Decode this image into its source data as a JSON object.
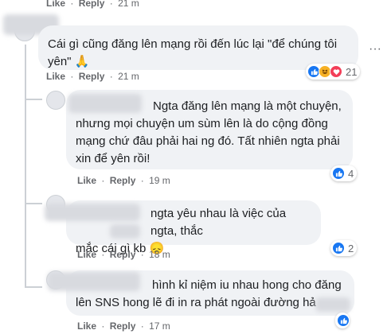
{
  "labels": {
    "like": "Like",
    "reply": "Reply",
    "dot": "·"
  },
  "comments": [
    {
      "time": "21 m"
    },
    {
      "lines": [
        "Cái gì cũng đăng lên mạng rồi đến lúc lại \"để chúng tôi",
        "yên\" 🙏"
      ],
      "time": "21 m",
      "reactions": "21"
    },
    {
      "lines": [
        "Ngta đăng lên mạng là một chuyện,",
        "nhưng mọi chuyện um sùm lên là do cộng đồng",
        "mạng chứ đâu phải hai ng đó. Tất nhiên ngta phải",
        "xin để yên rồi!"
      ],
      "time": "19 m",
      "reactions": "4"
    },
    {
      "lines": [
        "ngta yêu nhau là việc của ngta, thắc",
        "mắc cái    gì kb 😞"
      ],
      "time": "18 m",
      "reactions": "2"
    },
    {
      "lines": [
        "hình kỉ niệm iu nhau hong cho đăng",
        "lên SNS hong lẽ đi in ra phát ngoài đường hả"
      ],
      "time": "17 m"
    }
  ],
  "colors": {
    "like": "#1877f2",
    "haha": "#f7b125",
    "love": "#f33e58"
  },
  "icons": [
    "like-icon",
    "haha-icon",
    "love-icon",
    "more-options-icon"
  ]
}
